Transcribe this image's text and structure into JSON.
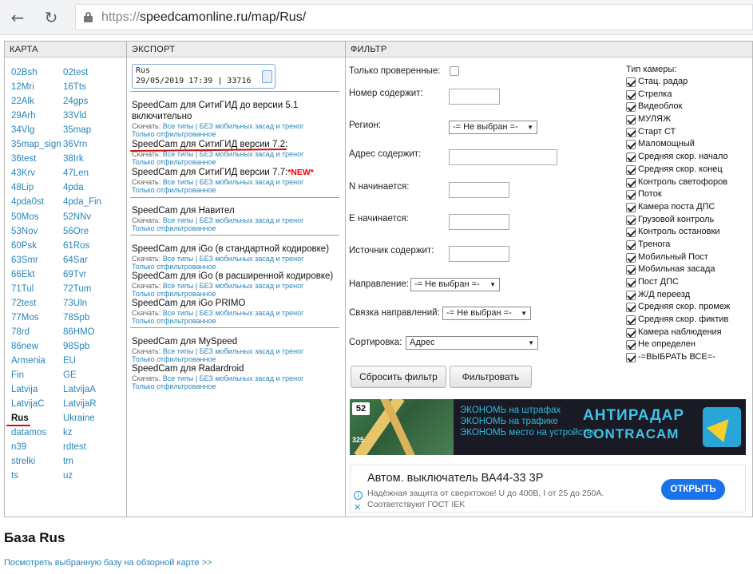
{
  "browser": {
    "url_protocol": "https://",
    "url_rest": "speedcamonline.ru/map/Rus/",
    "back_glyph": "←",
    "reload_glyph": "↻"
  },
  "headers": {
    "karta": "КАРТА",
    "export": "ЭКСПОРТ",
    "filter": "ФИЛЬТР"
  },
  "regions": {
    "col1": [
      "02Bsh",
      "12Mri",
      "22Alk",
      "29Arh",
      "34Vlg",
      "35map_sign",
      "36test",
      "43Krv",
      "48Lip",
      "4pda0st",
      "50Mos",
      "53Nov",
      "60Psk",
      "63Smr",
      "66Ekt",
      "71Tul",
      "72test",
      "77Mos",
      "78rd",
      "86new",
      "Armenia",
      "Fin",
      "Latvija",
      "LatvijaC",
      "Rus",
      "datamos",
      "n39",
      "strelki",
      "ts"
    ],
    "col2": [
      "02test",
      "16Tts",
      "24gps",
      "33Vld",
      "35map",
      "36Vrn",
      "38Irk",
      "47Len",
      "4pda",
      "4pda_Fin",
      "52NNv",
      "56Ore",
      "61Ros",
      "64Sar",
      "69Tvr",
      "72Tum",
      "73Uln",
      "78Spb",
      "86HMO",
      "98Spb",
      "EU",
      "GE",
      "LatvijaA",
      "LatvijaR",
      "Ukraine",
      "kz",
      "rdtest",
      "tm",
      "uz"
    ]
  },
  "export": {
    "info_name": "Rus",
    "info_stamp": "29/05/2019 17:39 | 33716",
    "download_prefix": "Скачать:",
    "all_types": "Все типы",
    "separator": "|",
    "no_mobile": "БЕЗ мобильных засад и треног",
    "filtered_only": "Только отфильтрованное",
    "new_badge": "*NEW*",
    "items": [
      {
        "title": "SpeedCam для СитиГИД до версии 5.1 включительно"
      },
      {
        "title": "SpeedCam для СитиГИД версии 7.2:"
      },
      {
        "title": "SpeedCam для СитиГИД версии 7.7:"
      },
      {
        "title": "SpeedCam для Навител"
      },
      {
        "title": "SpeedCam для iGo (в стандартной кодировке)"
      },
      {
        "title": "SpeedCam для iGo (в расширенной кодировке)"
      },
      {
        "title": "SpeedCam для iGo PRIMO"
      },
      {
        "title": "SpeedCam для MySpeed"
      },
      {
        "title": "SpeedCam для Radardroid"
      }
    ]
  },
  "filter": {
    "only_verified": "Только проверенные:",
    "number_contains": "Номер содержит:",
    "region": "Регион:",
    "region_value": "-= Не выбран =-",
    "address_contains": "Адрес содержит:",
    "n_starts": "N начинается:",
    "e_starts": "E начинается:",
    "source_contains": "Источник содержит:",
    "direction": "Направление:",
    "direction_value": "-= Не выбран =-",
    "dir_link": "Связка направлений:",
    "dir_link_value": "-= Не выбран =-",
    "sort": "Сортировка:",
    "sort_value": "Адрес",
    "reset_button": "Сбросить фильтр",
    "apply_button": "Фильтровать",
    "camera_types_title": "Тип камеры:",
    "camera_types": [
      "Стац. радар",
      "Стрелка",
      "Видеоблок",
      "МУЛЯЖ",
      "Старт СТ",
      "Маломощный",
      "Средняя скор. начало",
      "Средняя скор. конец",
      "Контроль светофоров",
      "Поток",
      "Камера поста ДПС",
      "Грузовой контроль",
      "Контроль остановки",
      "Тренога",
      "Мобильный Пост",
      "Мобильная засада",
      "Пост ДПС",
      "Ж/Д переезд",
      "Средняя скор. промеж",
      "Средняя скор. фиктив",
      "Камера наблюдения",
      "Не определен",
      "-=ВЫБРАТЬ ВСЕ=-"
    ]
  },
  "banner": {
    "speed": "52",
    "distance": "325",
    "line1": "ЭКОНОМЬ на штрафах",
    "line2": "ЭКОНОМЬ на трафике",
    "line3": "ЭКОНОМЬ место на устройстве",
    "brand1": "АНТИРАДАР",
    "brand2": "CONTRACAM"
  },
  "ad": {
    "title": "Автом. выключатель ВА44-33 3Р",
    "description": "Надёжная защита от сверхтоков! U до 400В, I от 25 до 250А. Соответствуют ГОСТ IEK",
    "button": "ОТКРЫТЬ",
    "info_glyph": "i",
    "close_glyph": "✕"
  },
  "footer": {
    "base_title": "База Rus",
    "base_link": "Посмотреть выбранную базу на обзорной карте >>"
  }
}
